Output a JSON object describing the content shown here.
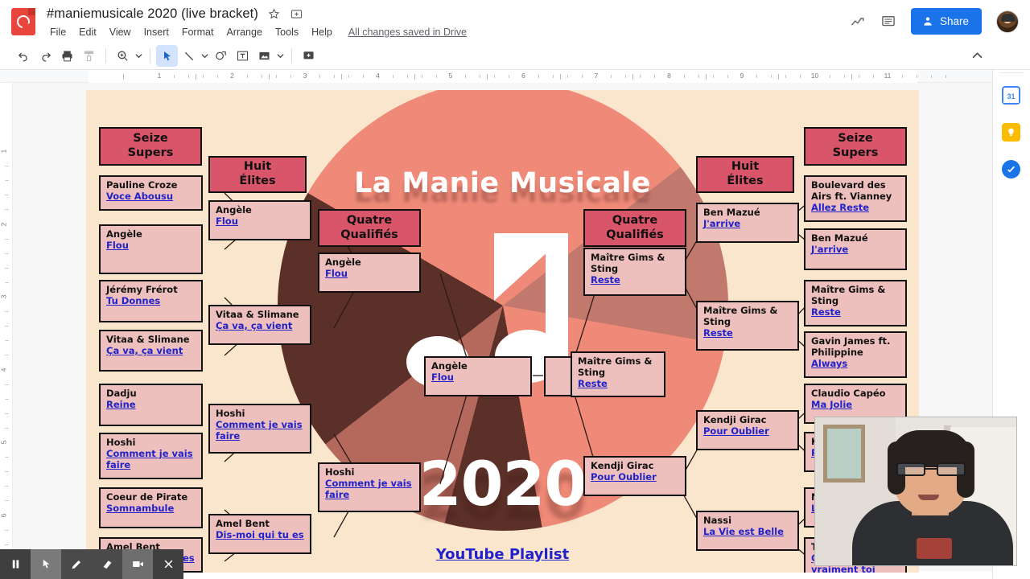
{
  "window": {
    "doc_title": "#maniemusicale 2020 (live bracket)",
    "save_state": "All changes saved in Drive",
    "menus": [
      "File",
      "Edit",
      "View",
      "Insert",
      "Format",
      "Arrange",
      "Tools",
      "Help"
    ],
    "share_label": "Share"
  },
  "toolbar": {
    "icons": [
      "undo-icon",
      "redo-icon",
      "print-icon",
      "paint-format-icon",
      "zoom-icon",
      "select-icon",
      "line-icon",
      "shape-icon",
      "textbox-icon",
      "image-icon",
      "comment-icon"
    ]
  },
  "rulers": {
    "horizontal_numbers": [
      "1",
      "2",
      "3",
      "4",
      "5",
      "6",
      "7",
      "8",
      "9",
      "10",
      "11"
    ],
    "vertical_numbers": [
      "1",
      "2",
      "3",
      "4",
      "5",
      "6"
    ]
  },
  "rail": {
    "items": [
      "google-calendar-icon",
      "google-keep-icon",
      "google-tasks-icon"
    ]
  },
  "recorder": {
    "buttons": [
      "pause-icon",
      "cursor-icon",
      "pen-icon",
      "eraser-icon",
      "camera-icon",
      "close-icon"
    ]
  },
  "slide": {
    "title": "La Manie Musicale",
    "year": "2020",
    "playlist_link": "YouTube Playlist",
    "round_headers": {
      "seize": "Seize\nSupers",
      "huit": "Huit\nÉlites",
      "quatre": "Quatre\nQualifiés"
    },
    "colors": {
      "background": "#fae5cd",
      "circle": "#f08a78",
      "wedge_dark": "#5b3029",
      "header_fill": "#d9556a",
      "box_fill": "#eec0bd",
      "link": "#2222cc"
    }
  },
  "bracket": {
    "left_r16": [
      {
        "artist": "Pauline Croze",
        "song": "Voce Abousu"
      },
      {
        "artist": "Angèle",
        "song": "Flou"
      },
      {
        "artist": "Jérémy Frérot",
        "song": "Tu Donnes"
      },
      {
        "artist": "Vitaa & Slimane",
        "song": "Ça va, ça vient"
      },
      {
        "artist": "Dadju",
        "song": "Reine"
      },
      {
        "artist": "Hoshi",
        "song": "Comment je vais faire"
      },
      {
        "artist": "Coeur de Pirate",
        "song": "Somnambule"
      },
      {
        "artist": "Amel Bent",
        "song": "Dis-moi qui tu es"
      }
    ],
    "left_r8": [
      {
        "artist": "Angèle",
        "song": "Flou"
      },
      {
        "artist": "Vitaa & Slimane",
        "song": "Ça va, ça vient"
      },
      {
        "artist": "Hoshi",
        "song": "Comment je vais faire"
      },
      {
        "artist": "Amel Bent",
        "song": "Dis-moi qui tu es"
      }
    ],
    "left_r4": [
      {
        "artist": "Angèle",
        "song": "Flou"
      },
      {
        "artist": "Hoshi",
        "song": "Comment je vais faire"
      }
    ],
    "left_final": {
      "artist": "Angèle",
      "song": "Flou"
    },
    "champion": {
      "artist": "",
      "song": ""
    },
    "right_final": {
      "artist": "Maître Gims & Sting",
      "song": "Reste"
    },
    "right_r4": [
      {
        "artist": "Maître Gims & Sting",
        "song": "Reste"
      },
      {
        "artist": "Kendji Girac",
        "song": "Pour Oublier"
      }
    ],
    "right_r8": [
      {
        "artist": "Ben Mazué",
        "song": "J'arrive"
      },
      {
        "artist": "Maître Gims & Sting",
        "song": "Reste"
      },
      {
        "artist": "Kendji Girac",
        "song": "Pour Oublier"
      },
      {
        "artist": "Nassi",
        "song": "La Vie est Belle"
      }
    ],
    "right_r16": [
      {
        "artist": "Boulevard des Airs ft. Vianney",
        "song": "Allez Reste"
      },
      {
        "artist": "Ben Mazué",
        "song": "J'arrive"
      },
      {
        "artist": "Maître Gims & Sting",
        "song": "Reste"
      },
      {
        "artist": "Gavin James ft. Philippine",
        "song": "Always"
      },
      {
        "artist": "Claudio Capéo",
        "song": "Ma Jolie"
      },
      {
        "artist": "Kendji Girac",
        "song": "Pour Oublier"
      },
      {
        "artist": "Nassi",
        "song": "La Vie est Belle"
      },
      {
        "artist": "Téléphone",
        "song": "Ça c'est vraiment toi"
      }
    ]
  }
}
